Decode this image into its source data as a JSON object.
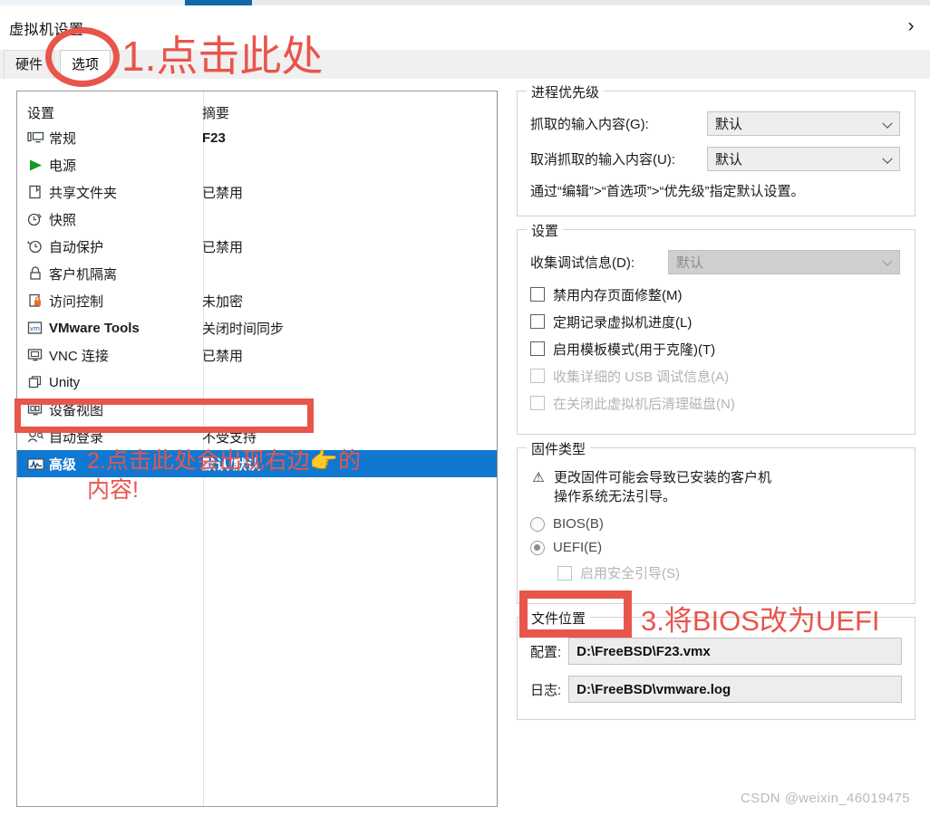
{
  "window": {
    "title": "虚拟机设置",
    "close_icon": "›"
  },
  "tabs": [
    {
      "label": "硬件",
      "active": false
    },
    {
      "label": "选项",
      "active": true
    }
  ],
  "settings_list": {
    "columns": {
      "setting": "设置",
      "summary": "摘要"
    },
    "rows": [
      {
        "icon": "monitor-icon",
        "label": "常规",
        "summary": "F23",
        "bold_summary": true,
        "selected": false
      },
      {
        "icon": "play-icon",
        "label": "电源",
        "summary": "",
        "selected": false
      },
      {
        "icon": "folder-icon",
        "label": "共享文件夹",
        "summary": "已禁用",
        "selected": false
      },
      {
        "icon": "snapshot-clock-icon",
        "label": "快照",
        "summary": "",
        "selected": false
      },
      {
        "icon": "history-clock-icon",
        "label": "自动保护",
        "summary": "已禁用",
        "selected": false
      },
      {
        "icon": "lock-icon",
        "label": "客户机隔离",
        "summary": "",
        "selected": false
      },
      {
        "icon": "access-control-lock-icon",
        "label": "访问控制",
        "summary": "未加密",
        "selected": false
      },
      {
        "icon": "vmware-tools-icon",
        "label": "VMware Tools",
        "summary": "关闭时间同步",
        "selected": false
      },
      {
        "icon": "vnc-icon",
        "label": "VNC 连接",
        "summary": "已禁用",
        "selected": false
      },
      {
        "icon": "unity-icon",
        "label": "Unity",
        "summary": "",
        "selected": false
      },
      {
        "icon": "device-view-icon",
        "label": "设备视图",
        "summary": "",
        "selected": false
      },
      {
        "icon": "auto-login-icon",
        "label": "自动登录",
        "summary": "不受支持",
        "selected": false
      },
      {
        "icon": "advanced-wave-icon",
        "label": "高级",
        "summary": "默认/默认",
        "selected": true
      }
    ]
  },
  "process_priority": {
    "title": "进程优先级",
    "grab_label": "抓取的输入内容(G):",
    "grab_value": "默认",
    "ungrab_label": "取消抓取的输入内容(U):",
    "ungrab_value": "默认",
    "hint": "通过“编辑”>“首选项”>“优先级”指定默认设置。"
  },
  "settings_group": {
    "title": "设置",
    "debug_label": "收集调试信息(D):",
    "debug_value": "默认",
    "checkboxes": [
      {
        "label": "禁用内存页面修整(M)",
        "checked": false,
        "disabled": false
      },
      {
        "label": "定期记录虚拟机进度(L)",
        "checked": false,
        "disabled": false
      },
      {
        "label": "启用模板模式(用于克隆)(T)",
        "checked": false,
        "disabled": false
      },
      {
        "label": "收集详细的 USB 调试信息(A)",
        "checked": false,
        "disabled": true
      },
      {
        "label": "在关闭此虚拟机后清理磁盘(N)",
        "checked": false,
        "disabled": true
      }
    ]
  },
  "firmware": {
    "title": "固件类型",
    "warning_icon": "⚠",
    "warning_text": "更改固件可能会导致已安装的客户机\n操作系统无法引导。",
    "options": [
      {
        "label": "BIOS(B)",
        "checked": false
      },
      {
        "label": "UEFI(E)",
        "checked": true
      }
    ],
    "secure_boot": {
      "label": "启用安全引导(S)",
      "checked": false,
      "disabled": true
    }
  },
  "file_location": {
    "title": "文件位置",
    "config_label": "配置:",
    "config_value": "D:\\FreeBSD\\F23.vmx",
    "log_label": "日志:",
    "log_value": "D:\\FreeBSD\\vmware.log"
  },
  "annotations": {
    "color": "#e8554b",
    "step1": "1.点击此处",
    "step2": "2.点击此处会出现右边👉的\n内容!",
    "step3": "3.将BIOS改为UEFI"
  },
  "watermark": "CSDN @weixin_46019475"
}
